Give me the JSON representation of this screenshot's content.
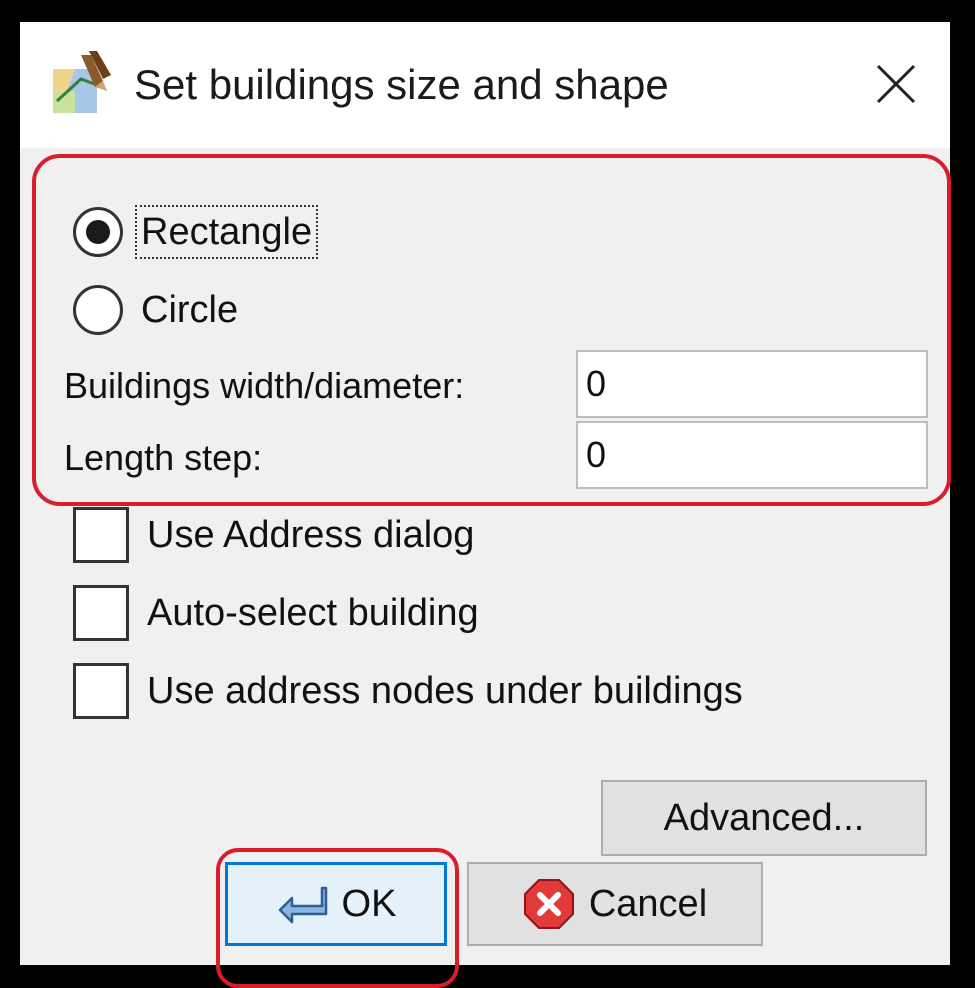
{
  "window": {
    "title": "Set buildings size and shape",
    "icon": "josm-app-icon",
    "close_icon": "close-icon"
  },
  "shape": {
    "selected": "Rectangle",
    "options": [
      {
        "label": "Rectangle",
        "checked": true
      },
      {
        "label": "Circle",
        "checked": false
      }
    ]
  },
  "fields": {
    "width_label": "Buildings width/diameter:",
    "width_value": "0",
    "length_step_label": "Length step:",
    "length_step_value": "0"
  },
  "checkboxes": [
    {
      "label": "Use Address dialog",
      "checked": false
    },
    {
      "label": "Auto-select building",
      "checked": false
    },
    {
      "label": "Use address nodes under buildings",
      "checked": false
    }
  ],
  "buttons": {
    "advanced": "Advanced...",
    "ok": "OK",
    "cancel": "Cancel"
  },
  "colors": {
    "highlight": "#d81e2c",
    "ok_focus_border": "#0078d7",
    "dialog_bg": "#f0f0f0"
  }
}
